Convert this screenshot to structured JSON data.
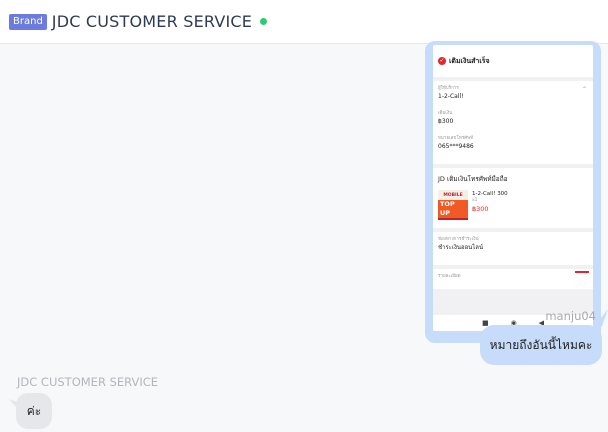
{
  "header": {
    "brand_badge": "Brand",
    "title": "JDC CUSTOMER SERVICE",
    "status_color": "#2ecc71"
  },
  "screenshot_message": {
    "success_text": "เติมเงินสำเร็จ",
    "fields": [
      {
        "label": "ผู้ให้บริการ",
        "value": "1-2-Call!"
      },
      {
        "label": "เติมเงิน",
        "value": "฿300"
      },
      {
        "label": "หมายเลขโทรศัพท์",
        "value": "065***9486"
      }
    ],
    "section_title": "JD เติมเงินโทรศัพท์มือถือ",
    "product": {
      "image_top": "MOBILE",
      "image_main": "TOP UP",
      "name": "1-2-Call! 300",
      "qty": "x1",
      "price": "฿300"
    },
    "payment": {
      "label": "ช่องทางการชำระเงิน",
      "value": "ชำระเงินออนไลน์"
    },
    "next_label": "รายละเอียด",
    "navbar": {
      "square": "■",
      "circle": "◉",
      "back": "◀"
    }
  },
  "messages": {
    "outgoing_sender": "manju04",
    "outgoing_text": "หมายถึงอันนี้ไหมคะ",
    "incoming_sender": "JDC CUSTOMER SERVICE",
    "incoming_text": "ค่ะ"
  },
  "colors": {
    "outgoing_bubble": "#c7dcfa",
    "incoming_bubble": "#e6e7ea",
    "brand_badge": "#6b7be0"
  }
}
